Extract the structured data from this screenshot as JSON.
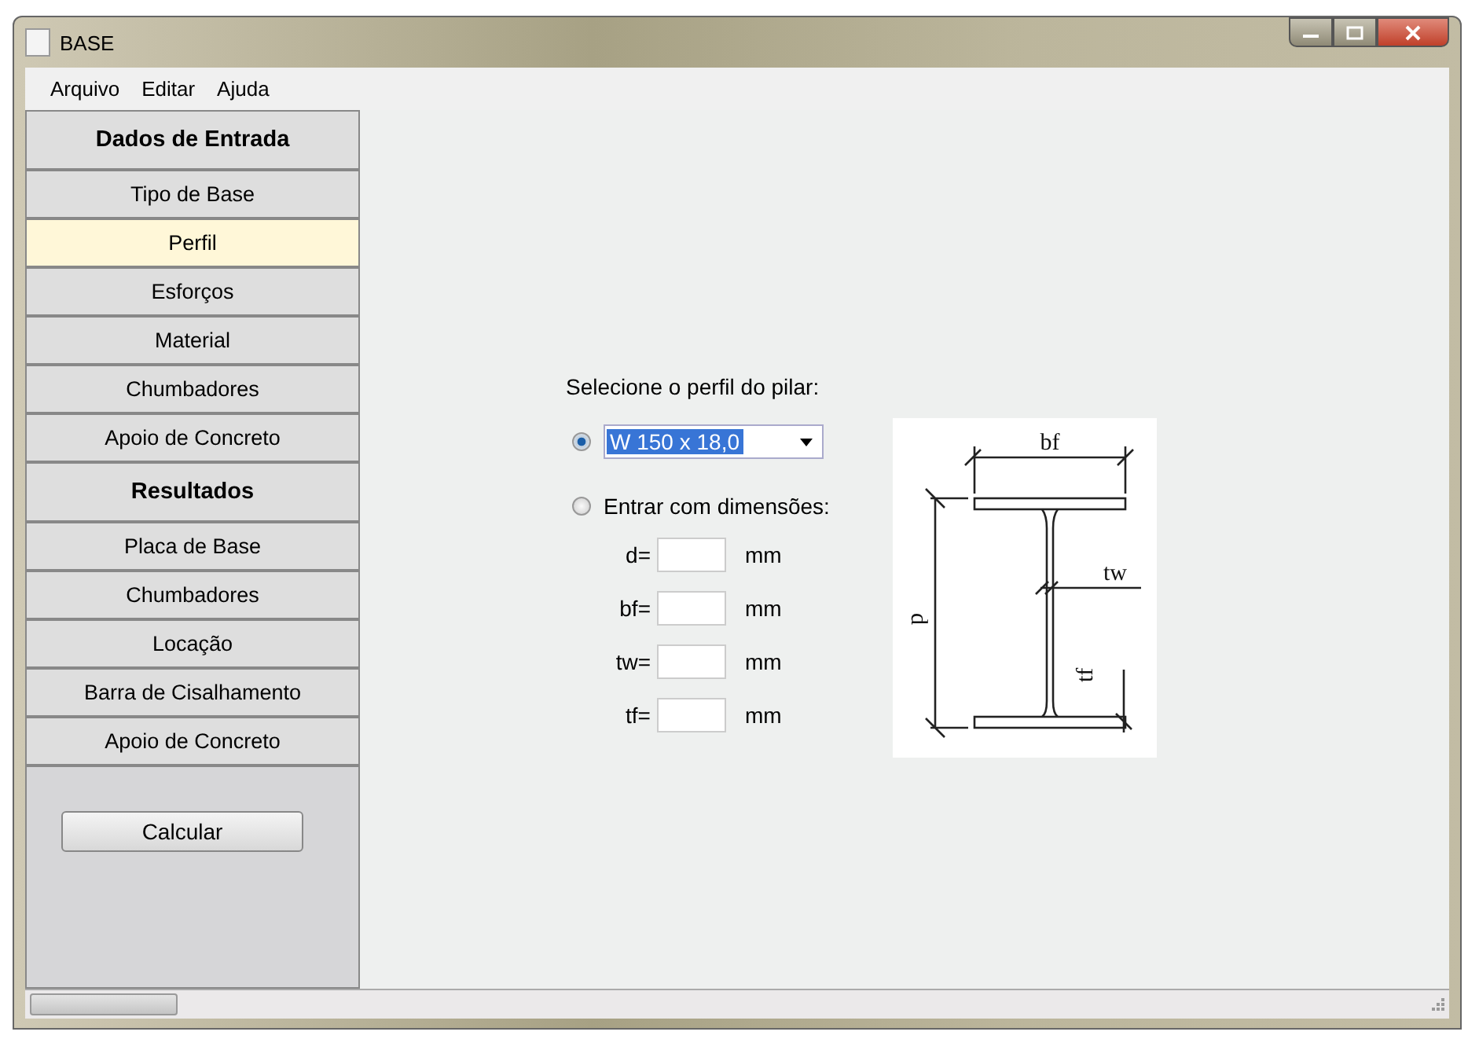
{
  "window": {
    "title": "BASE"
  },
  "menu": [
    "Arquivo",
    "Editar",
    "Ajuda"
  ],
  "sidebar": {
    "items": [
      {
        "kind": "header",
        "label": "Dados de Entrada",
        "selected": false
      },
      {
        "kind": "item",
        "label": "Tipo de Base",
        "selected": false
      },
      {
        "kind": "item",
        "label": "Perfil",
        "selected": true
      },
      {
        "kind": "item",
        "label": "Esforços",
        "selected": false
      },
      {
        "kind": "item",
        "label": "Material",
        "selected": false
      },
      {
        "kind": "item",
        "label": "Chumbadores",
        "selected": false
      },
      {
        "kind": "item",
        "label": "Apoio de Concreto",
        "selected": false
      },
      {
        "kind": "header",
        "label": "Resultados",
        "selected": false
      },
      {
        "kind": "item",
        "label": "Placa de Base",
        "selected": false
      },
      {
        "kind": "item",
        "label": "Chumbadores",
        "selected": false
      },
      {
        "kind": "item",
        "label": "Locação",
        "selected": false
      },
      {
        "kind": "item",
        "label": "Barra de Cisalhamento",
        "selected": false
      },
      {
        "kind": "item",
        "label": "Apoio de Concreto",
        "selected": false
      }
    ],
    "button": "Calcular"
  },
  "form": {
    "prompt": "Selecione o perfil do pilar:",
    "options": [
      {
        "kind": "dropdown",
        "selected": true,
        "value": "W 150 x 18,0"
      },
      {
        "kind": "manual",
        "selected": false,
        "label": "Entrar com dimensões:"
      }
    ],
    "fields": [
      {
        "label": "d=",
        "unit": "mm"
      },
      {
        "label": "bf=",
        "unit": "mm"
      },
      {
        "label": "tw=",
        "unit": "mm"
      },
      {
        "label": "tf=",
        "unit": "mm"
      }
    ]
  },
  "diagram": {
    "labels": [
      "bf",
      "tw",
      "d",
      "tf"
    ]
  }
}
